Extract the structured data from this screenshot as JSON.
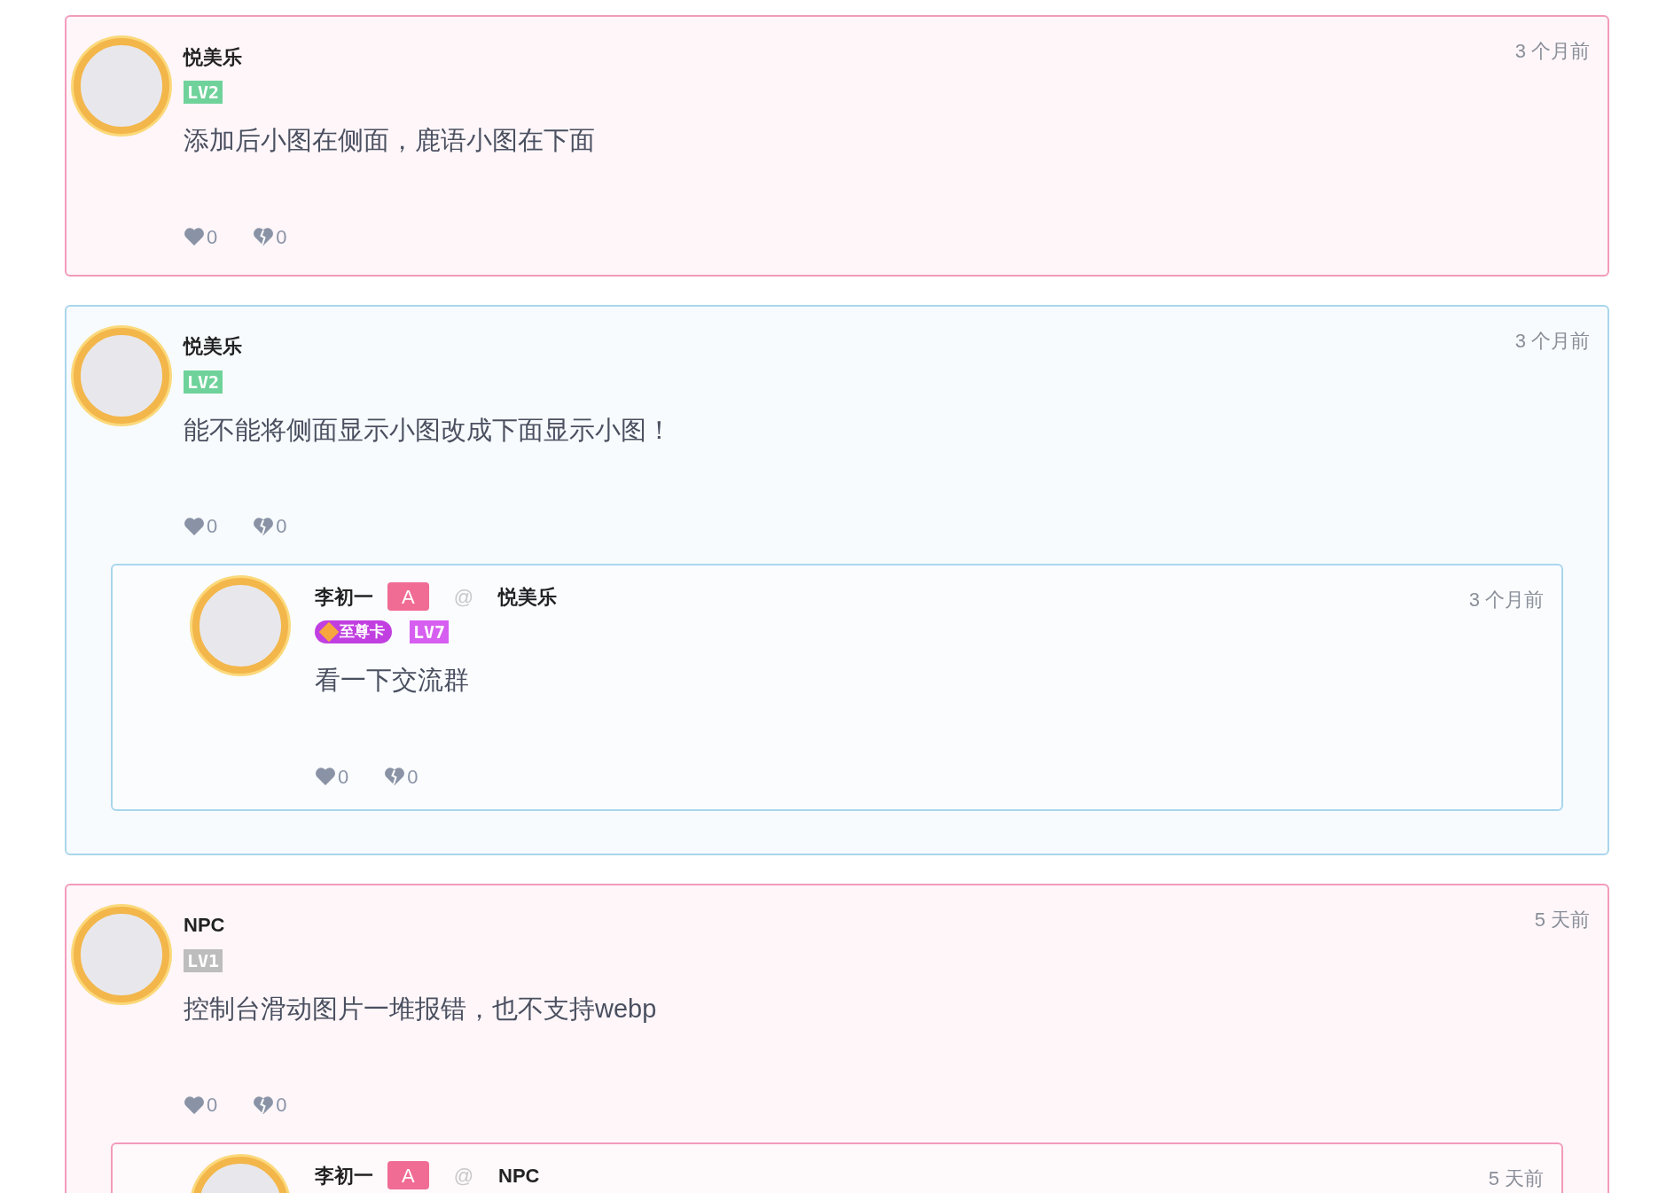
{
  "comments": [
    {
      "color": "#f29bbb",
      "user": {
        "name": "悦美乐",
        "badges": [
          {
            "kind": "level",
            "text": "LV2",
            "color": "#6fd29a"
          }
        ]
      },
      "time": "3 个月前",
      "text": "添加后小图在侧面，鹿语小图在下面",
      "likes": "0",
      "dislikes": "0"
    },
    {
      "color": "#a9d6ec",
      "user": {
        "name": "悦美乐",
        "badges": [
          {
            "kind": "level",
            "text": "LV2",
            "color": "#6fd29a"
          }
        ]
      },
      "time": "3 个月前",
      "text": "能不能将侧面显示小图改成下面显示小图！",
      "likes": "0",
      "dislikes": "0",
      "replies": [
        {
          "user": {
            "name": "李初一",
            "tag": "A",
            "badges": [
              {
                "kind": "vip",
                "text": "至尊卡",
                "color": "#c13fe0"
              },
              {
                "kind": "level",
                "text": "LV7",
                "color": "#d65ef0"
              }
            ]
          },
          "at": "@",
          "target": "悦美乐",
          "time": "3 个月前",
          "text": "看一下交流群",
          "likes": "0",
          "dislikes": "0"
        }
      ]
    },
    {
      "color": "#f29bbb",
      "user": {
        "name": "NPC",
        "badges": [
          {
            "kind": "level",
            "text": "LV1",
            "color": "#bdbdbd"
          }
        ]
      },
      "time": "5 天前",
      "text": "控制台滑动图片一堆报错，也不支持webp",
      "likes": "0",
      "dislikes": "0",
      "replies": [
        {
          "user": {
            "name": "李初一",
            "tag": "A"
          },
          "at": "@",
          "target": "NPC",
          "time": "5 天前"
        }
      ]
    }
  ]
}
